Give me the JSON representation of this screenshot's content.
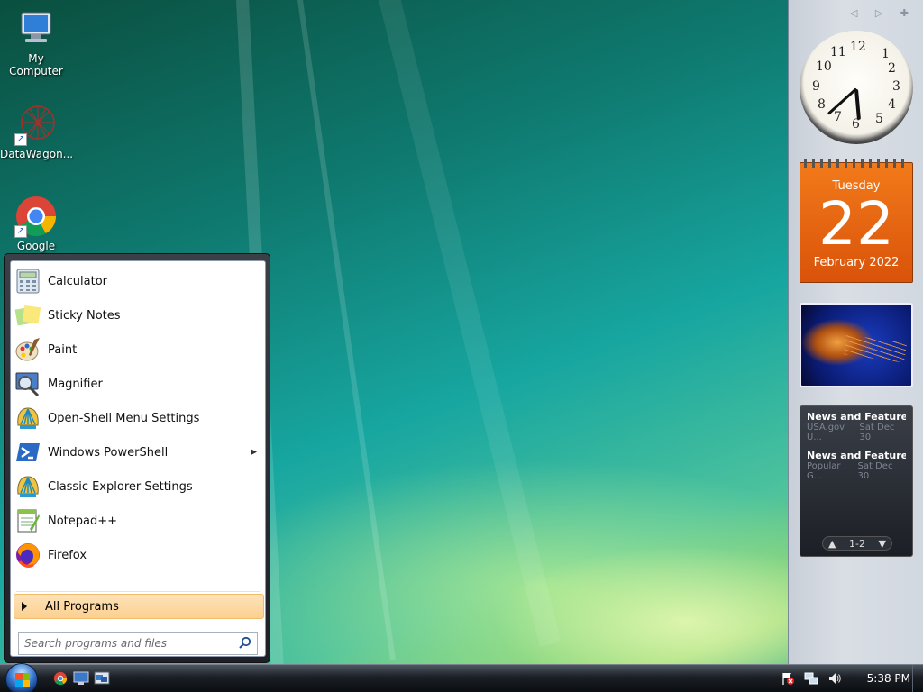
{
  "desktop": {
    "icons": [
      {
        "label": "My Computer",
        "icon": "computer-icon"
      },
      {
        "label": "DataWagon...",
        "icon": "network-ball-icon"
      },
      {
        "label": "Google",
        "icon": "chrome-icon"
      }
    ]
  },
  "start_menu": {
    "items": [
      {
        "label": "Calculator",
        "icon": "calculator-icon"
      },
      {
        "label": "Sticky Notes",
        "icon": "sticky-notes-icon"
      },
      {
        "label": "Paint",
        "icon": "paint-icon"
      },
      {
        "label": "Magnifier",
        "icon": "magnifier-icon"
      },
      {
        "label": "Open-Shell Menu Settings",
        "icon": "shell-icon"
      },
      {
        "label": "Windows PowerShell",
        "icon": "powershell-icon",
        "submenu": true
      },
      {
        "label": "Classic Explorer Settings",
        "icon": "shell-icon"
      },
      {
        "label": "Notepad++",
        "icon": "notepadpp-icon"
      },
      {
        "label": "Firefox",
        "icon": "firefox-icon"
      }
    ],
    "all_programs": "All Programs",
    "search_placeholder": "Search programs and files"
  },
  "sidebar": {
    "calendar": {
      "weekday": "Tuesday",
      "day": "22",
      "month_year": "February 2022"
    },
    "clock": {
      "hour": 5,
      "minute": 38
    },
    "feeds": [
      {
        "title": "News and Features f...",
        "source": "USA.gov U...",
        "date": "Sat Dec 30"
      },
      {
        "title": "News and Features f...",
        "source": "Popular G...",
        "date": "Sat Dec 30"
      }
    ],
    "feed_page": "1-2"
  },
  "taskbar": {
    "time": "5:38 PM",
    "quick_launch": [
      "chrome-icon",
      "show-desktop-icon",
      "switch-windows-icon"
    ],
    "tray_icons": [
      "action-center-flag-icon",
      "network-icon",
      "volume-icon"
    ]
  },
  "colors": {
    "calendar_orange": "#e8650f",
    "all_programs_highlight": "#fbd08f"
  }
}
